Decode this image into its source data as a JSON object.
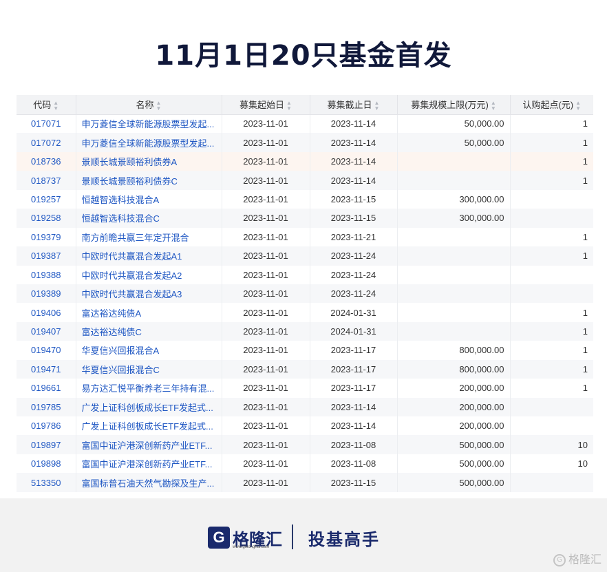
{
  "title": "11月1日20只基金首发",
  "table": {
    "headers": [
      "代码",
      "名称",
      "募集起始日",
      "募集截止日",
      "募集规模上限(万元)",
      "认购起点(元)"
    ],
    "sort_icon": "sort-icon",
    "rows": [
      [
        "017071",
        "申万菱信全球新能源股票型发起...",
        "2023-11-01",
        "2023-11-14",
        "50,000.00",
        "1"
      ],
      [
        "017072",
        "申万菱信全球新能源股票型发起...",
        "2023-11-01",
        "2023-11-14",
        "50,000.00",
        "1"
      ],
      [
        "018736",
        "景顺长城景颐裕利债券A",
        "2023-11-01",
        "2023-11-14",
        "",
        "1"
      ],
      [
        "018737",
        "景顺长城景颐裕利债券C",
        "2023-11-01",
        "2023-11-14",
        "",
        "1"
      ],
      [
        "019257",
        "恒越智选科技混合A",
        "2023-11-01",
        "2023-11-15",
        "300,000.00",
        ""
      ],
      [
        "019258",
        "恒越智选科技混合C",
        "2023-11-01",
        "2023-11-15",
        "300,000.00",
        ""
      ],
      [
        "019379",
        "南方前瞻共赢三年定开混合",
        "2023-11-01",
        "2023-11-21",
        "",
        "1"
      ],
      [
        "019387",
        "中欧时代共赢混合发起A1",
        "2023-11-01",
        "2023-11-24",
        "",
        "1"
      ],
      [
        "019388",
        "中欧时代共赢混合发起A2",
        "2023-11-01",
        "2023-11-24",
        "",
        ""
      ],
      [
        "019389",
        "中欧时代共赢混合发起A3",
        "2023-11-01",
        "2023-11-24",
        "",
        ""
      ],
      [
        "019406",
        "富达裕达纯债A",
        "2023-11-01",
        "2024-01-31",
        "",
        "1"
      ],
      [
        "019407",
        "富达裕达纯债C",
        "2023-11-01",
        "2024-01-31",
        "",
        "1"
      ],
      [
        "019470",
        "华夏信兴回报混合A",
        "2023-11-01",
        "2023-11-17",
        "800,000.00",
        "1"
      ],
      [
        "019471",
        "华夏信兴回报混合C",
        "2023-11-01",
        "2023-11-17",
        "800,000.00",
        "1"
      ],
      [
        "019661",
        "易方达汇悦平衡养老三年持有混...",
        "2023-11-01",
        "2023-11-17",
        "200,000.00",
        "1"
      ],
      [
        "019785",
        "广发上证科创板成长ETF发起式...",
        "2023-11-01",
        "2023-11-14",
        "200,000.00",
        ""
      ],
      [
        "019786",
        "广发上证科创板成长ETF发起式...",
        "2023-11-01",
        "2023-11-14",
        "200,000.00",
        ""
      ],
      [
        "019897",
        "富国中证沪港深创新药产业ETF...",
        "2023-11-01",
        "2023-11-08",
        "500,000.00",
        "10"
      ],
      [
        "019898",
        "富国中证沪港深创新药产业ETF...",
        "2023-11-01",
        "2023-11-08",
        "500,000.00",
        "10"
      ],
      [
        "513350",
        "富国标普石油天然气勘探及生产...",
        "2023-11-01",
        "2023-11-15",
        "500,000.00",
        ""
      ]
    ]
  },
  "footer": {
    "logo_letter": "G",
    "logo_text": "格隆汇",
    "logo_url": "www.gelonghui.com",
    "slogan": "投基高手",
    "watermark": "格隆汇",
    "watermark_icon_glyph": "G"
  },
  "colors": {
    "title": "#10183a",
    "link": "#1f57c3",
    "header_bg": "#f2f3f5",
    "highlight_row": "#fdf5f0",
    "brand": "#1a2a6c"
  }
}
